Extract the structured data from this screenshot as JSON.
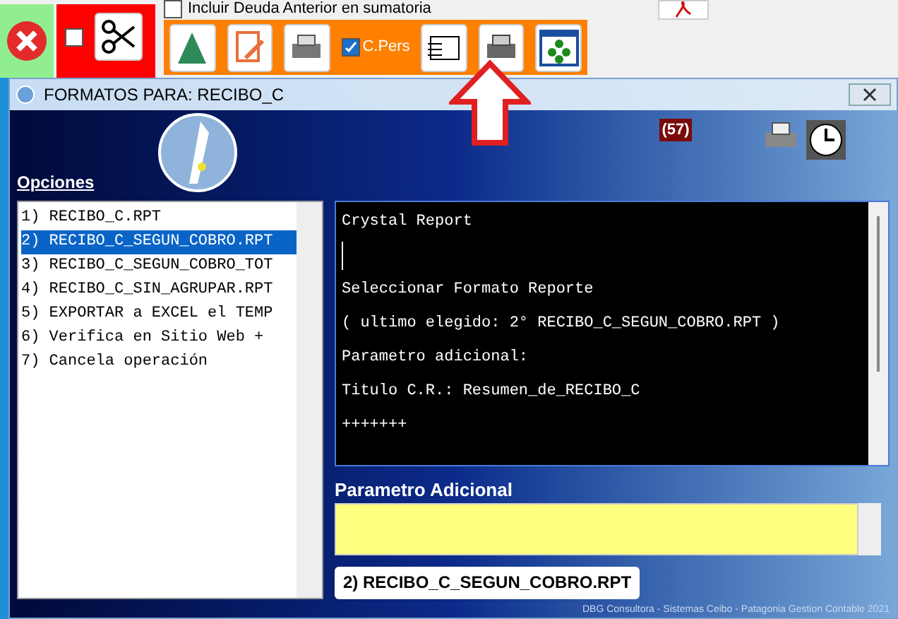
{
  "top_checkbox": {
    "label": "Incluir Deuda Anterior en sumatoria",
    "checked": false
  },
  "toolbar": {
    "red_checkbox_checked": false,
    "pers_checkbox": {
      "label": "C.Pers",
      "checked": true
    }
  },
  "dialog": {
    "title": "FORMATOS PARA: RECIBO_C",
    "badge": "(57)",
    "options_label": "Opciones",
    "options": [
      {
        "label": "1) RECIBO_C.RPT",
        "selected": false
      },
      {
        "label": "2) RECIBO_C_SEGUN_COBRO.RPT",
        "selected": true
      },
      {
        "label": "3) RECIBO_C_SEGUN_COBRO_TOT",
        "selected": false
      },
      {
        "label": "4) RECIBO_C_SIN_AGRUPAR.RPT",
        "selected": false
      },
      {
        "label": "5) EXPORTAR a EXCEL el TEMP",
        "selected": false
      },
      {
        "label": "6) Verifica en Sitio Web + ",
        "selected": false
      },
      {
        "label": "7) Cancela operación",
        "selected": false
      }
    ],
    "console_lines": [
      {
        "kind": "text",
        "text": "Crystal Report"
      },
      {
        "kind": "cursor"
      },
      {
        "kind": "text",
        "text": "Seleccionar Formato Reporte"
      },
      {
        "kind": "text",
        "text": "( ultimo elegido: 2° RECIBO_C_SEGUN_COBRO.RPT )"
      },
      {
        "kind": "text",
        "text": "Parametro adicional:"
      },
      {
        "kind": "text",
        "text": "Titulo C.R.: Resumen_de_RECIBO_C"
      },
      {
        "kind": "text",
        "text": "+++++++"
      }
    ],
    "param_label": "Parametro Adicional",
    "selected_button": "2) RECIBO_C_SEGUN_COBRO.RPT",
    "footer": "DBG Consultora - Sistemas Ceibo - Patagonia Gestion Contable 2021"
  }
}
